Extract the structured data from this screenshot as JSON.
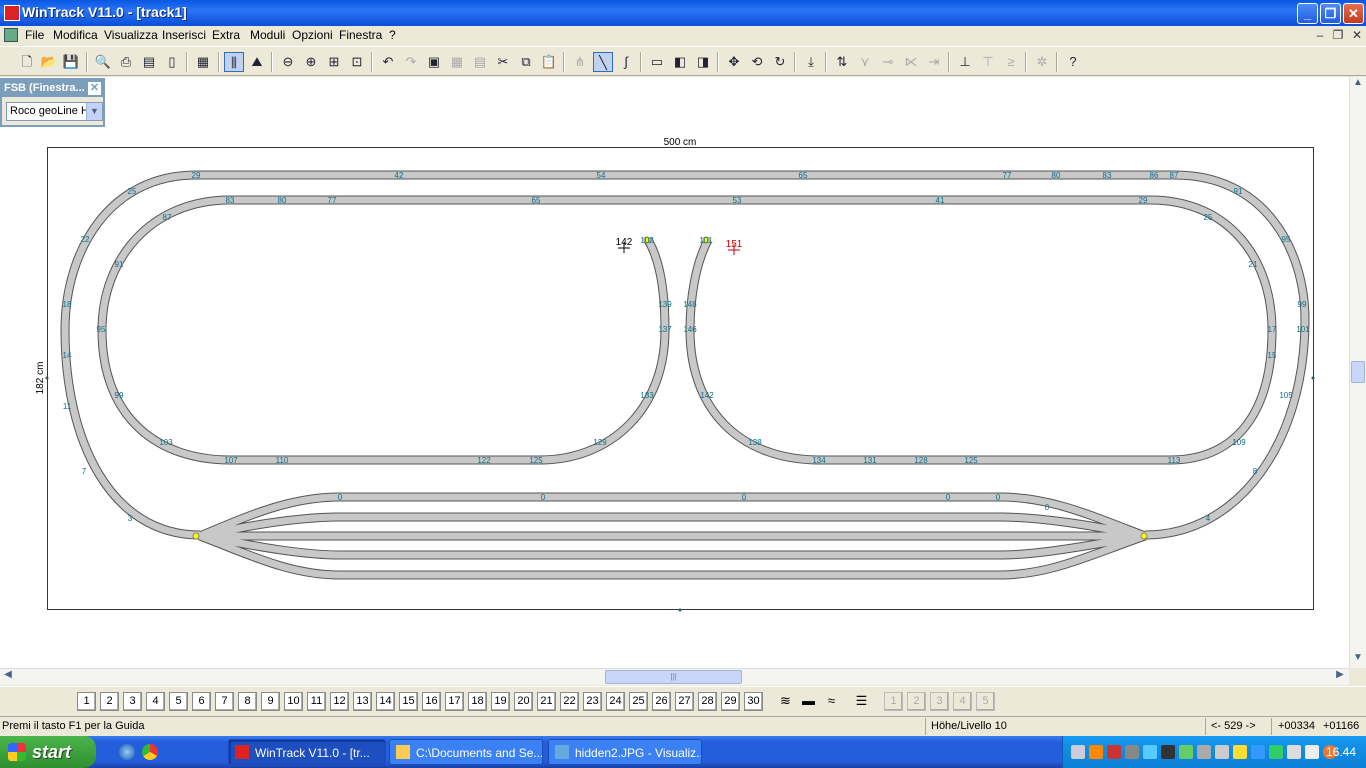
{
  "window": {
    "title": "WinTrack  V11.0 - [track1]"
  },
  "menu": [
    "File",
    "Modifica",
    "Visualizza",
    "Inserisci",
    "Extra",
    "Moduli",
    "Opzioni",
    "Finestra",
    "?"
  ],
  "fsb": {
    "title": "FSB (Finestra...",
    "selected": "Roco geoLine H"
  },
  "canvas": {
    "dim_width": "500 cm",
    "dim_height": "182 cm",
    "markers": {
      "black": "142",
      "red": "151",
      "left_end": "102",
      "right_end": "101"
    },
    "outer_top_labels": [
      "29",
      "42",
      "54",
      "65",
      "77",
      "80",
      "83",
      "86",
      "87"
    ],
    "inner_top_labels": [
      "83",
      "80",
      "77",
      "65",
      "53",
      "41",
      "29"
    ],
    "left_outer_labels": [
      "25",
      "22",
      "18",
      "14",
      "11",
      "7",
      "3"
    ],
    "left_inner_labels": [
      "87",
      "91",
      "95",
      "99",
      "103",
      "107",
      "110",
      "122",
      "125"
    ],
    "inner_left_loop_labels": [
      "129",
      "133",
      "137",
      "139"
    ],
    "inner_right_loop_labels": [
      "148",
      "146",
      "142",
      "138",
      "134",
      "131",
      "128",
      "125"
    ],
    "right_outer_labels": [
      "91",
      "95",
      "99",
      "101",
      "105",
      "8",
      "4"
    ],
    "right_inner_labels": [
      "25",
      "21",
      "17",
      "15",
      "109",
      "113"
    ],
    "yard_labels": [
      "0",
      "0",
      "0",
      "0",
      "0",
      "0"
    ]
  },
  "layers": [
    "1",
    "2",
    "3",
    "4",
    "5",
    "6",
    "7",
    "8",
    "9",
    "10",
    "11",
    "12",
    "13",
    "14",
    "15",
    "16",
    "17",
    "18",
    "19",
    "20",
    "21",
    "22",
    "23",
    "24",
    "25",
    "26",
    "27",
    "28",
    "29",
    "30"
  ],
  "layer_extra": [
    "1",
    "2",
    "3",
    "4",
    "5"
  ],
  "status": {
    "help": "Premi il tasto F1 per la Guida",
    "level": "Höhe/Livello 10",
    "angle": "<- 529 ->",
    "x": "+00334",
    "y": "+01166"
  },
  "taskbar": {
    "start": "start",
    "tasks": [
      "WinTrack  V11.0 - [tr...",
      "C:\\Documents and Se...",
      "hidden2.JPG - Visualiz..."
    ],
    "clock": "16.44"
  }
}
